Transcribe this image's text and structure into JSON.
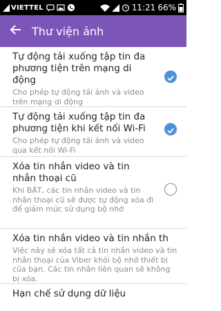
{
  "status_bar": {
    "carrier": "VIETTEL",
    "time": "11:21",
    "battery": "66%"
  },
  "app_bar": {
    "title": "Thư viện ảnh"
  },
  "settings": [
    {
      "title": "Tự động tải xuống tập tin đa phương tiện trên mạng di động",
      "description": "Cho phép tự động tải ảnh và video trên mạng di động",
      "checked": true
    },
    {
      "title": "Tự động tải xuống tập tin đa phương tiện khi kết nối Wi-Fi",
      "description": "Cho phép tự động tải ảnh và video qua kết nối Wi-Fi",
      "checked": true
    },
    {
      "title": "Xóa tin nhắn video và tin nhắn thoại cũ",
      "description": "Khi BẬT, các tin nhắn video và tin nhắn thoại cũ sẽ được tự động xóa đi để giảm mức sử dụng bộ nhớ",
      "checked": false
    },
    {
      "title": "Xóa tin nhắn video và tin nhắn th",
      "description": "Việc này sẽ xóa tất cả tin nhắn video và tin nhắn thoại của Viber khỏi bộ nhớ thiết bị của bạn. Các tin nhắn liên quan sẽ không bị xóa."
    },
    {
      "title": "Hạn chế sử dụng dữ liệu"
    }
  ],
  "colors": {
    "accent": "#7b55b8",
    "check": "#4e92d6"
  }
}
